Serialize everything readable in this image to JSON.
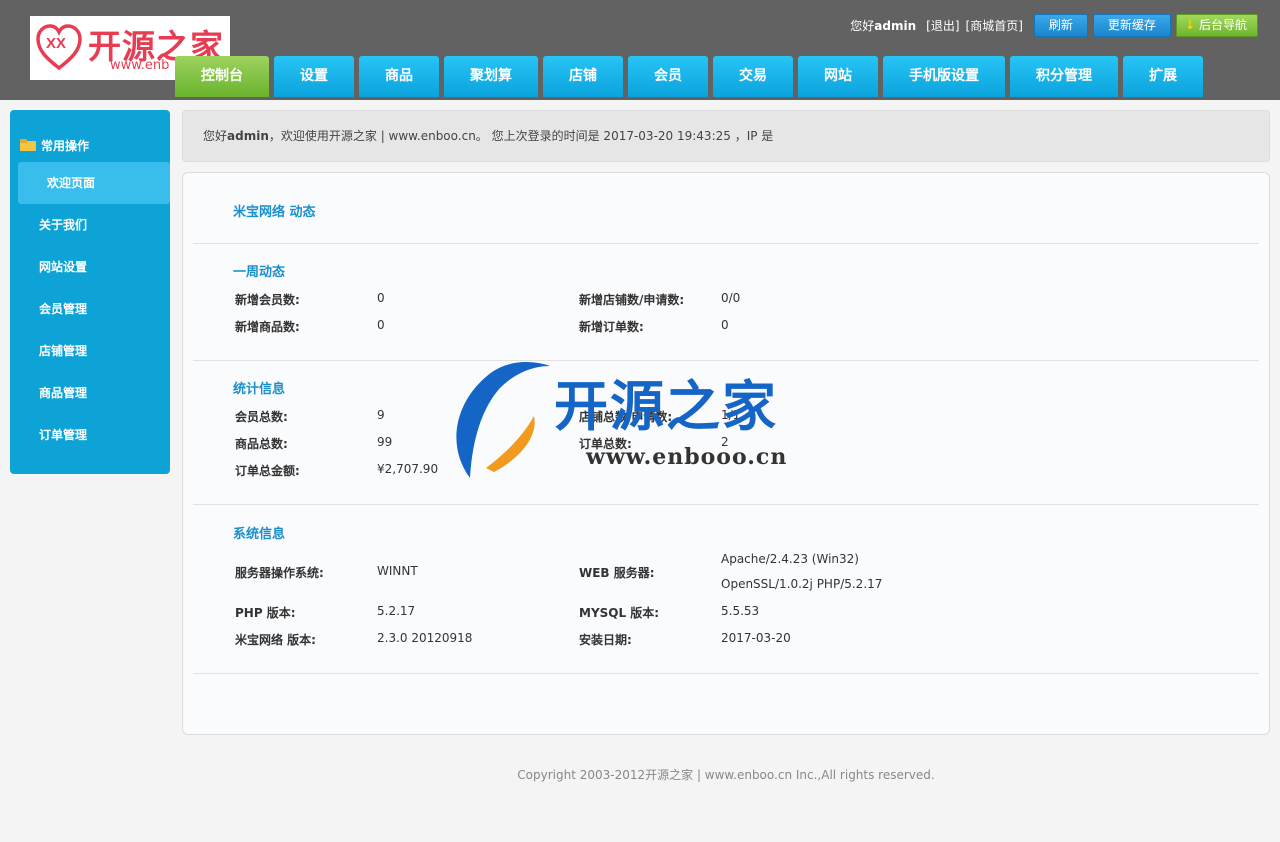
{
  "brand": {
    "logo_text": "开源之家",
    "logo_url": "www.enb"
  },
  "top": {
    "greeting_prefix": "您好",
    "user": "admin",
    "logout": "[退出]",
    "store_home": "[商城首页]",
    "refresh": "刷新",
    "update_cache": "更新缓存",
    "admin_nav": "后台导航"
  },
  "nav": {
    "items": [
      "控制台",
      "设置",
      "商品",
      "聚划算",
      "店铺",
      "会员",
      "交易",
      "网站",
      "手机版设置",
      "积分管理",
      "扩展"
    ]
  },
  "sidebar": {
    "heading": "常用操作",
    "items": [
      "欢迎页面",
      "关于我们",
      "网站设置",
      "会员管理",
      "店铺管理",
      "商品管理",
      "订单管理"
    ]
  },
  "welcome": {
    "prefix": "您好",
    "user": "admin",
    "message": "，欢迎使用开源之家 | www.enboo.cn。  您上次登录的时间是 2017-03-20 19:43:25 ，IP 是"
  },
  "panel": {
    "header": "米宝网络 动态",
    "weekly": {
      "title": "一周动态",
      "new_members_label": "新增会员数:",
      "new_members": "0",
      "new_stores_label": "新增店铺数/申请数:",
      "new_stores": "0/0",
      "new_goods_label": "新增商品数:",
      "new_goods": "0",
      "new_orders_label": "新增订单数:",
      "new_orders": "0"
    },
    "stats": {
      "title": "统计信息",
      "members_label": "会员总数:",
      "members": "9",
      "stores_label": "店铺总数/申请数:",
      "stores": "1/1",
      "goods_label": "商品总数:",
      "goods": "99",
      "orders_label": "订单总数:",
      "orders": "2",
      "amount_label": "订单总金额:",
      "amount": "¥2,707.90"
    },
    "system": {
      "title": "系统信息",
      "os_label": "服务器操作系统:",
      "os": "WINNT",
      "web_label": "WEB 服务器:",
      "web_line1": "Apache/2.4.23 (Win32)",
      "web_line2": "OpenSSL/1.0.2j PHP/5.2.17",
      "php_label": "PHP 版本:",
      "php": "5.2.17",
      "mysql_label": "MYSQL 版本:",
      "mysql": "5.5.53",
      "version_label": "米宝网络 版本:",
      "version": "2.3.0 20120918",
      "install_label": "安装日期:",
      "install": "2017-03-20"
    }
  },
  "footer": "Copyright 2003-2012开源之家 | www.enboo.cn Inc.,All rights reserved.",
  "watermark": {
    "text": "开源之家",
    "url": "www.enbooo.cn"
  },
  "colors": {
    "header_bg": "#626262",
    "accent_blue": "#0ea3d6",
    "accent_green": "#69b42d",
    "section_title": "#1a8fcd",
    "logo_red": "#e83c52"
  }
}
